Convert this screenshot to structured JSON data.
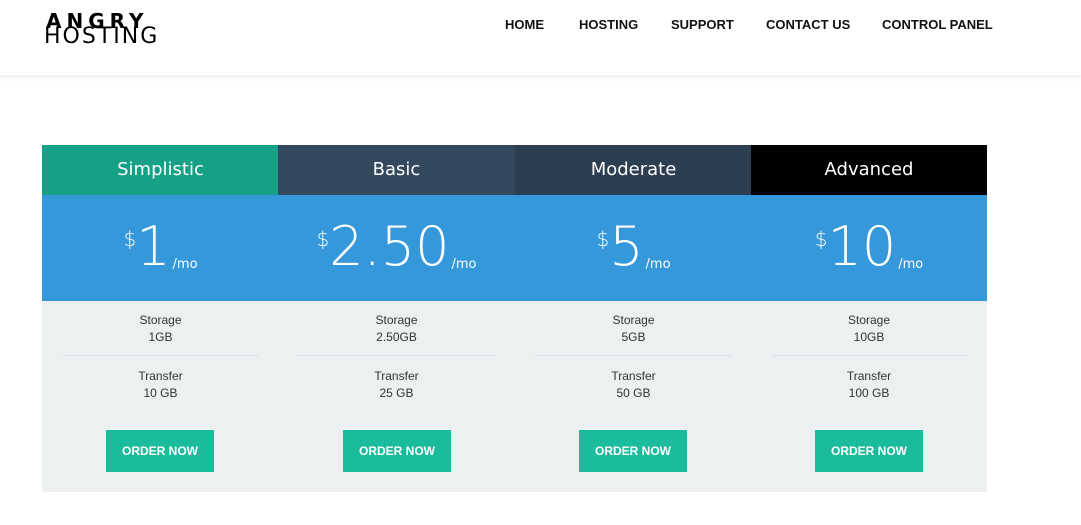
{
  "logo": {
    "line1": "ANGRY",
    "line2": "HOSTING"
  },
  "nav": [
    {
      "label": "HOME"
    },
    {
      "label": "HOSTING"
    },
    {
      "label": "SUPPORT"
    },
    {
      "label": "CONTACT US"
    },
    {
      "label": "CONTROL PANEL"
    }
  ],
  "plans": [
    {
      "name": "Simplistic",
      "header_color": "#16a085",
      "currency": "$",
      "amount": "1",
      "period": "/mo",
      "features": [
        {
          "label": "Storage",
          "value": "1GB"
        },
        {
          "label": "Transfer",
          "value": "10 GB"
        }
      ],
      "cta": "ORDER NOW"
    },
    {
      "name": "Basic",
      "header_color": "#34495e",
      "currency": "$",
      "amount": "2.50",
      "period": "/mo",
      "features": [
        {
          "label": "Storage",
          "value": "2.50GB"
        },
        {
          "label": "Transfer",
          "value": "25 GB"
        }
      ],
      "cta": "ORDER NOW"
    },
    {
      "name": "Moderate",
      "header_color": "#2c3e50",
      "currency": "$",
      "amount": "5",
      "period": "/mo",
      "features": [
        {
          "label": "Storage",
          "value": "5GB"
        },
        {
          "label": "Transfer",
          "value": "50 GB"
        }
      ],
      "cta": "ORDER NOW"
    },
    {
      "name": "Advanced",
      "header_color": "#000000",
      "currency": "$",
      "amount": "10",
      "period": "/mo",
      "features": [
        {
          "label": "Storage",
          "value": "10GB"
        },
        {
          "label": "Transfer",
          "value": "100 GB"
        }
      ],
      "cta": "ORDER NOW"
    }
  ],
  "colors": {
    "price_band": "#3498db",
    "button": "#1abc9c",
    "body_bg": "#ecf0f1"
  }
}
